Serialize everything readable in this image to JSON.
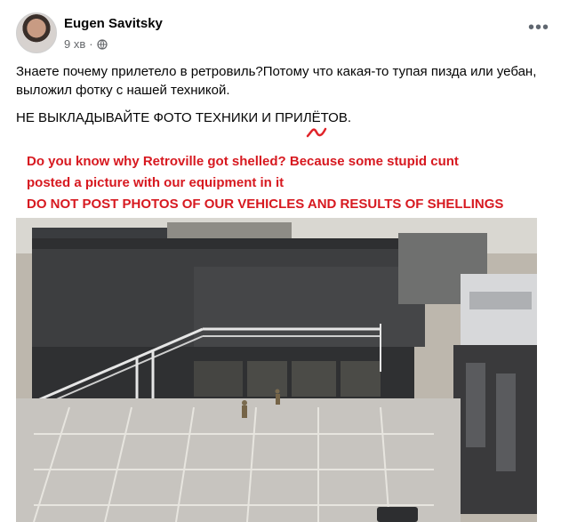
{
  "post": {
    "author": "Eugen Savitsky",
    "time": "9 хв",
    "privacy_icon": "globe-icon",
    "more_icon": "more-options-icon",
    "text_paragraph_1": "Знаете почему прилетело в ретровиль?Потому что какая-то тупая пизда или уебан, выложил фотку с нашей техникой.",
    "text_paragraph_2": "НЕ ВЫКЛАДЫВАЙТЕ ФОТО ТЕХНИКИ И ПРИЛЁТОВ."
  },
  "image": {
    "caption_line_1": "Do you know why Retroville got shelled? Because some stupid cunt",
    "caption_line_2": "posted a picture with our equipment in it",
    "caption_line_3": "DO NOT POST PHOTOS OF OUR VEHICLES AND RESULTS OF SHELLINGS"
  },
  "colors": {
    "caption_red": "#d71920",
    "squiggle_red": "#e0242a",
    "facebook_text": "#050505",
    "muted_text": "#65676b"
  }
}
